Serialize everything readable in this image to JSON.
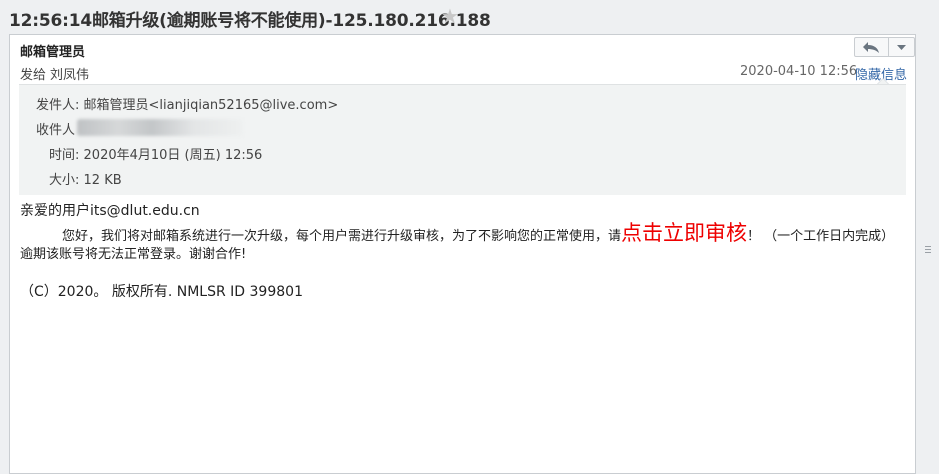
{
  "subject": "12:56:14邮箱升级(逾期账号将不能使用)-125.180.216.188",
  "header": {
    "sender_name": "邮箱管理员",
    "send_to_prefix": "发给",
    "send_to_name": "刘凤伟",
    "date": "2020-04-10 12:56",
    "hide_info_label": "隐藏信息"
  },
  "details": {
    "from_label": "发件人:",
    "from_value": "邮箱管理员<lianjiqian52165@live.com>",
    "to_label": "收件人",
    "time_label": "时间:",
    "time_value": "2020年4月10日 (周五) 12:56",
    "size_label": "大小:",
    "size_value": "12 KB"
  },
  "body": {
    "greeting": "亲爱的用户its@dlut.edu.cn",
    "paragraph_start": "您好，我们将对邮箱系统进行一次升级，每个用户需进行升级审核，为了不影响您的正常使用，请",
    "cta_link": "点击立即审核",
    "paragraph_end": "！ （一个工作日内完成）",
    "line3": "逾期该账号将无法正常登录。谢谢合作!",
    "copyright": "（C）2020。 版权所有. NMLSR ID 399801"
  },
  "icons": {
    "star": "star-icon",
    "reply": "reply-arrow-icon",
    "more": "chevron-down-icon"
  },
  "colors": {
    "cta": "#e00000",
    "link": "#3568a8"
  }
}
